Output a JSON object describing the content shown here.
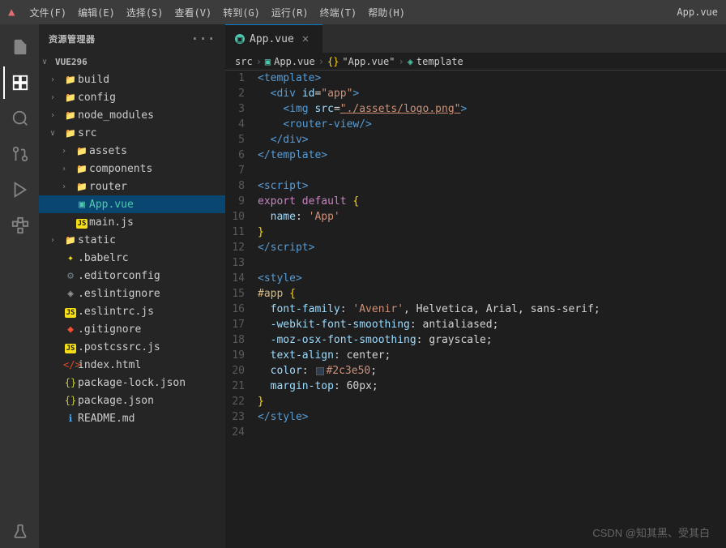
{
  "titlebar": {
    "icon": "▲",
    "menus": [
      "文件(F)",
      "编辑(E)",
      "选择(S)",
      "查看(V)",
      "转到(G)",
      "运行(R)",
      "终端(T)",
      "帮助(H)"
    ],
    "app_name": "App.vue"
  },
  "sidebar": {
    "header": "资源管理器",
    "dots": "···",
    "root": "VUE296",
    "items": [
      {
        "indent": 1,
        "arrow": "›",
        "icon": "",
        "label": "build",
        "icon_color": ""
      },
      {
        "indent": 1,
        "arrow": "›",
        "icon": "",
        "label": "config",
        "icon_color": ""
      },
      {
        "indent": 1,
        "arrow": "›",
        "icon": "",
        "label": "node_modules",
        "icon_color": ""
      },
      {
        "indent": 1,
        "arrow": "∨",
        "icon": "",
        "label": "src",
        "icon_color": ""
      },
      {
        "indent": 2,
        "arrow": "›",
        "icon": "",
        "label": "assets",
        "icon_color": ""
      },
      {
        "indent": 2,
        "arrow": "›",
        "icon": "",
        "label": "components",
        "icon_color": ""
      },
      {
        "indent": 2,
        "arrow": "›",
        "icon": "",
        "label": "router",
        "icon_color": ""
      },
      {
        "indent": 2,
        "arrow": "",
        "icon": "▣",
        "label": "App.vue",
        "icon_color": "#4ec9b0",
        "selected": true
      },
      {
        "indent": 2,
        "arrow": "",
        "icon": "JS",
        "label": "main.js",
        "icon_color": "#f5de19"
      },
      {
        "indent": 1,
        "arrow": "›",
        "icon": "",
        "label": "static",
        "icon_color": ""
      },
      {
        "indent": 1,
        "arrow": "",
        "icon": "✦",
        "label": ".babelrc",
        "icon_color": "#f5de19"
      },
      {
        "indent": 1,
        "arrow": "",
        "icon": "⚙",
        "label": ".editorconfig",
        "icon_color": "#6d8086"
      },
      {
        "indent": 1,
        "arrow": "",
        "icon": "◈",
        "label": ".eslintignore",
        "icon_color": "#4b4b4b"
      },
      {
        "indent": 1,
        "arrow": "",
        "icon": "◈",
        "label": ".eslintrc.js",
        "icon_color": "#6d8086"
      },
      {
        "indent": 1,
        "arrow": "",
        "icon": "◆",
        "label": ".gitignore",
        "icon_color": "#f14e32"
      },
      {
        "indent": 1,
        "arrow": "",
        "icon": "JS",
        "label": ".postcssrc.js",
        "icon_color": "#f5de19"
      },
      {
        "indent": 1,
        "arrow": "",
        "icon": "<>",
        "label": "index.html",
        "icon_color": "#e44d26"
      },
      {
        "indent": 1,
        "arrow": "",
        "icon": "{}",
        "label": "package-lock.json",
        "icon_color": "#cbcb41"
      },
      {
        "indent": 1,
        "arrow": "",
        "icon": "{}",
        "label": "package.json",
        "icon_color": "#cbcb41"
      },
      {
        "indent": 1,
        "arrow": "",
        "icon": "ℹ",
        "label": "README.md",
        "icon_color": "#42a5f5"
      }
    ]
  },
  "tabs": [
    {
      "label": "App.vue",
      "active": true
    }
  ],
  "breadcrumb": {
    "src": "src",
    "sep1": ">",
    "vue_icon": "▣",
    "app_vue": "App.vue",
    "sep2": ">",
    "bracket_open": "{}",
    "app_vue2": "\"App.vue\"",
    "sep3": ">",
    "template_icon": "◈",
    "template": "template"
  },
  "code_lines": [
    {
      "num": 1,
      "content": "template_open"
    },
    {
      "num": 2,
      "content": "div_id_app"
    },
    {
      "num": 3,
      "content": "img_src"
    },
    {
      "num": 4,
      "content": "router_view"
    },
    {
      "num": 5,
      "content": "div_close"
    },
    {
      "num": 6,
      "content": "template_close"
    },
    {
      "num": 7,
      "content": "empty"
    },
    {
      "num": 8,
      "content": "script_open"
    },
    {
      "num": 9,
      "content": "export_default"
    },
    {
      "num": 10,
      "content": "name_app"
    },
    {
      "num": 11,
      "content": "obj_close"
    },
    {
      "num": 12,
      "content": "script_close"
    },
    {
      "num": 13,
      "content": "empty"
    },
    {
      "num": 14,
      "content": "style_open"
    },
    {
      "num": 15,
      "content": "hash_app"
    },
    {
      "num": 16,
      "content": "font_family"
    },
    {
      "num": 17,
      "content": "webkit_font"
    },
    {
      "num": 18,
      "content": "moz_osx"
    },
    {
      "num": 19,
      "content": "text_align"
    },
    {
      "num": 20,
      "content": "color"
    },
    {
      "num": 21,
      "content": "margin_top"
    },
    {
      "num": 22,
      "content": "brace_close"
    },
    {
      "num": 23,
      "content": "style_close"
    },
    {
      "num": 24,
      "content": "empty"
    }
  ],
  "watermark": "CSDN @知其黑、受其白"
}
